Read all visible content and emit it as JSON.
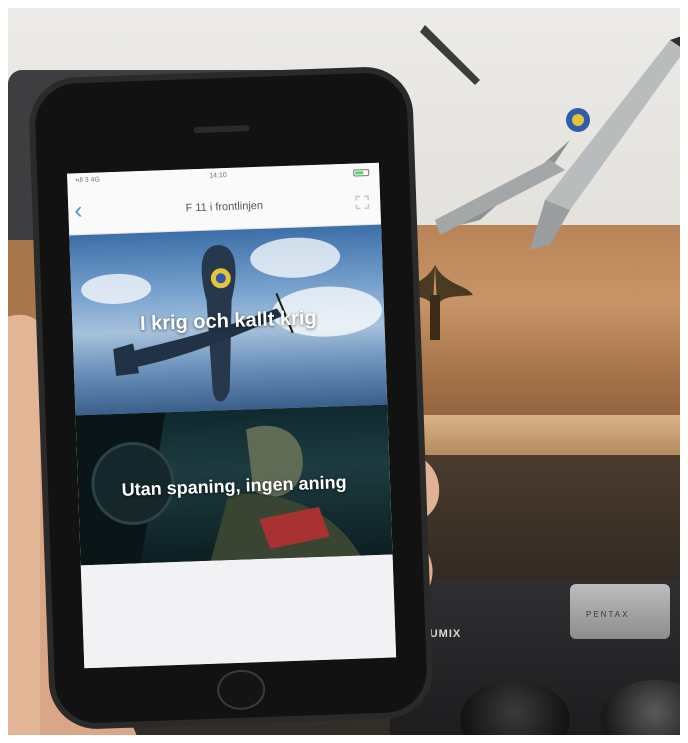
{
  "app": {
    "status_bar": {
      "signal": "•ıll 3   4G",
      "time": "14:10"
    },
    "nav": {
      "title": "F 11 i frontlinjen",
      "back_icon": "chevron-left-icon",
      "expand_icon": "expand-icon"
    },
    "cards": [
      {
        "title": "I krig och kallt krig",
        "image": "spitfire-plane-in-sky"
      },
      {
        "title": "Utan spaning, ingen aning",
        "image": "pilot-in-cockpit"
      },
      {
        "title": "",
        "image": "blank"
      }
    ]
  },
  "scene": {
    "camera_brand": "LUMIX",
    "camera_brand_2": "PENTAX"
  },
  "colors": {
    "accent": "#4a90d9",
    "sky": "#6d93bd",
    "cockpit": "#1d3b40"
  }
}
